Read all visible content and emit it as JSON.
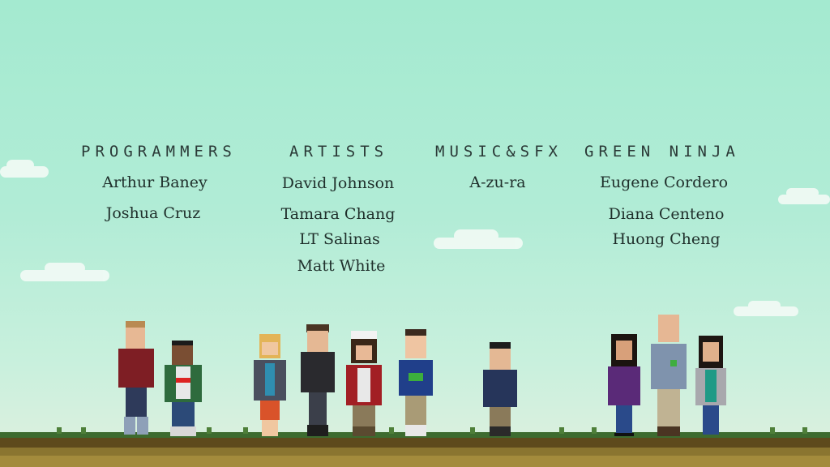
{
  "credits": {
    "programmers": {
      "heading": "PROGRAMMERS",
      "names": [
        "Arthur Baney",
        "Joshua Cruz"
      ]
    },
    "artists": {
      "heading": "ARTISTS",
      "names": [
        "David Johnson",
        "Tamara Chang",
        "LT Salinas",
        "Matt White"
      ]
    },
    "music": {
      "heading": "MUSIC&SFX",
      "names": [
        "A-zu-ra"
      ]
    },
    "green_ninja": {
      "heading": "GREEN NINJA",
      "names": [
        "Eugene Cordero",
        "Diana Centeno",
        "Huong Cheng"
      ]
    }
  },
  "colors": {
    "sky_top": "#a4ead0",
    "text": "#1f2f2b",
    "grass": "#3d6b2f",
    "dirt": "#8a7530"
  }
}
